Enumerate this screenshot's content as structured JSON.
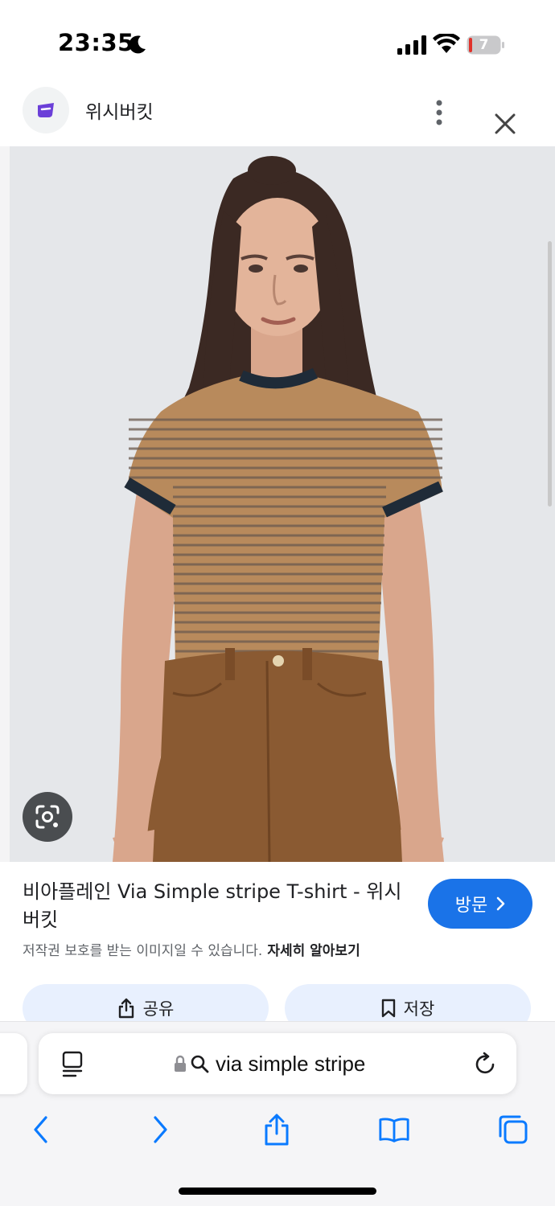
{
  "status_bar": {
    "time": "23:35",
    "battery_level": "7",
    "icons": [
      "moon-icon",
      "cellular-signal-icon",
      "wifi-icon",
      "battery-icon"
    ]
  },
  "header": {
    "site_name": "위시버킷",
    "icons": [
      "wishbucket-logo-icon",
      "more-vertical-icon",
      "close-icon"
    ]
  },
  "image": {
    "icons": [
      "google-lens-icon"
    ]
  },
  "info": {
    "title": "비아플레인 Via Simple stripe T-shirt - 위시버킷",
    "visit_label": "방문",
    "copyright_text": "저작권 보호를 받는 이미지일 수 있습니다.",
    "learn_more": "자세히 알아보기",
    "share_label": "공유",
    "save_label": "저장"
  },
  "browser": {
    "url_text": "via simple stripe",
    "icons": [
      "reader-mode-icon",
      "lock-icon",
      "search-icon",
      "reload-icon",
      "back-icon",
      "forward-icon",
      "share-icon",
      "bookmarks-icon",
      "tabs-icon"
    ]
  },
  "colors": {
    "accent": "#1a73e8",
    "chip_background": "#e8f0fe",
    "toolbar_blue": "#0a7aff"
  }
}
